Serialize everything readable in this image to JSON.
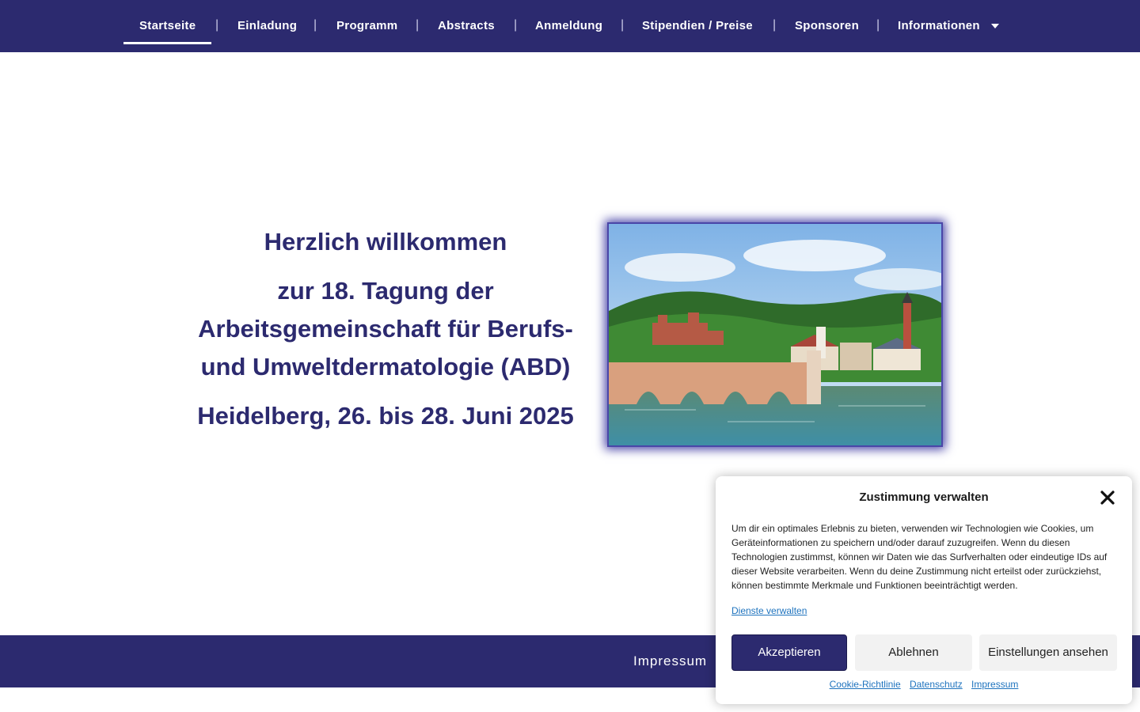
{
  "nav": {
    "items": [
      {
        "label": "Startseite"
      },
      {
        "label": "Einladung"
      },
      {
        "label": "Programm"
      },
      {
        "label": "Abstracts"
      },
      {
        "label": "Anmeldung"
      },
      {
        "label": "Stipendien / Preise"
      },
      {
        "label": "Sponsoren"
      },
      {
        "label": "Informationen"
      }
    ],
    "separator": "|",
    "active": "Startseite"
  },
  "hero": {
    "welcome": "Herzlich willkommen",
    "event": "zur 18. Tagung der Arbeitsgemeinschaft für Berufs- und Umweltdermatologie (ABD)",
    "dates": "Heidelberg, 26. bis 28. Juni 2025"
  },
  "footer": {
    "impressum": "Impressum"
  },
  "consent": {
    "title": "Zustimmung verwalten",
    "body": "Um dir ein optimales Erlebnis zu bieten, verwenden wir Technologien wie Cookies, um Geräteinformationen zu speichern und/oder darauf zuzugreifen. Wenn du diesen Technologien zustimmst, können wir Daten wie das Surfverhalten oder eindeutige IDs auf dieser Website verarbeiten. Wenn du deine Zustimmung nicht erteilst oder zurückziehst, können bestimmte Merkmale und Funktionen beeinträchtigt werden.",
    "manage_link": "Dienste verwalten",
    "accept": "Akzeptieren",
    "deny": "Ablehnen",
    "preferences": "Einstellungen ansehen",
    "links": {
      "cookie_policy": "Cookie-Richtlinie",
      "privacy": "Datenschutz",
      "imprint": "Impressum"
    }
  },
  "colors": {
    "brand": "#2c2a6f",
    "link": "#1e73be"
  }
}
